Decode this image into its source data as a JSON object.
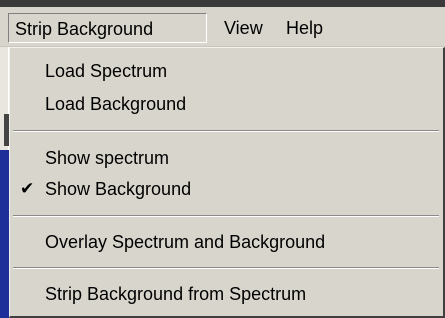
{
  "menubar": {
    "items": [
      {
        "label": "Strip Background",
        "active": true
      },
      {
        "label": "View"
      },
      {
        "label": "Help"
      }
    ]
  },
  "dropdown": {
    "items": [
      {
        "label": "Load Spectrum"
      },
      {
        "label": "Load Background"
      },
      {
        "label": "Show spectrum",
        "checked": false
      },
      {
        "label": "Show Background",
        "checked": true,
        "check_glyph": "✔"
      },
      {
        "label": "Overlay Spectrum and Background"
      },
      {
        "label": "Strip Background from Spectrum"
      }
    ]
  }
}
